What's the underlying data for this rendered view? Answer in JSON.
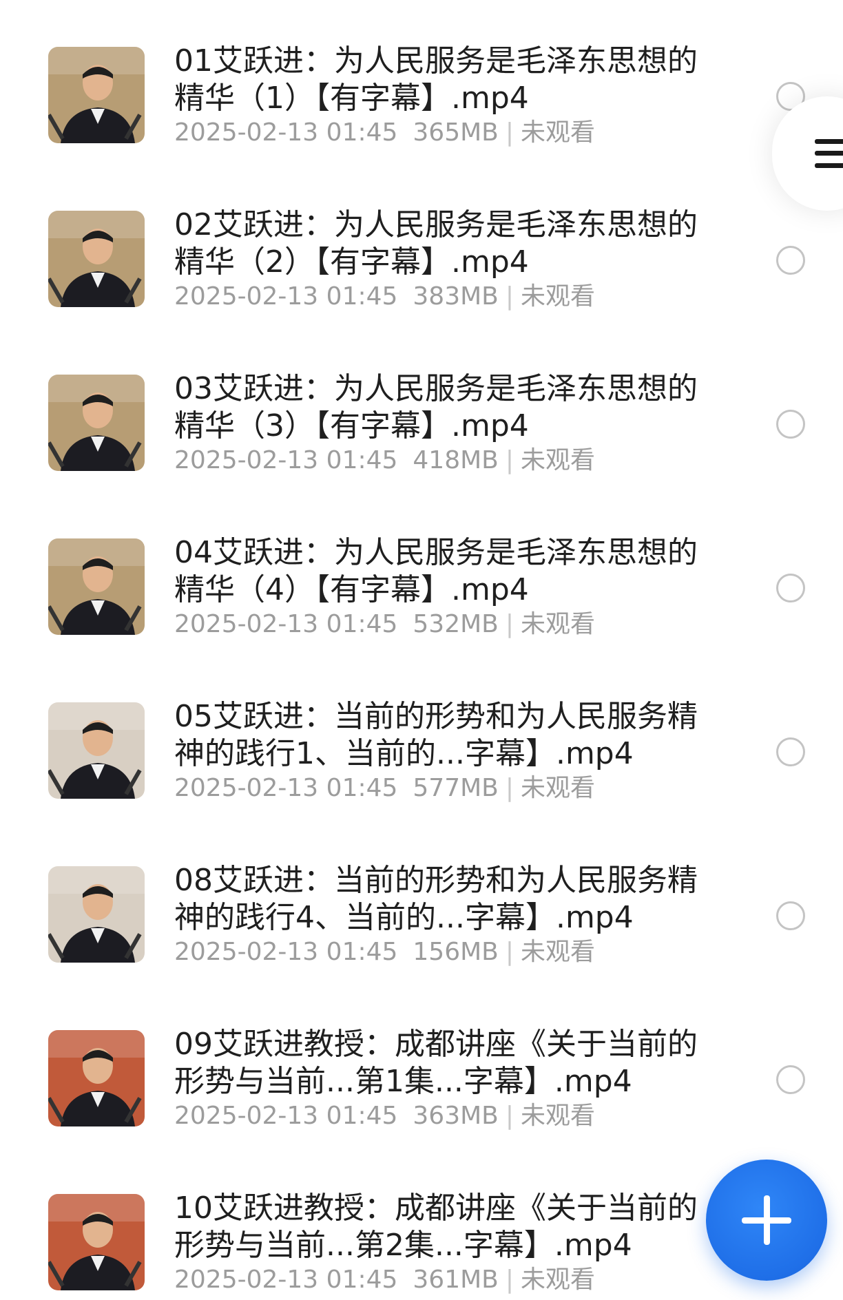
{
  "files": [
    {
      "title": "01艾跃进：为人民服务是毛泽东思想的精华（1）【有字幕】.mp4",
      "date": "2025-02-13 01:45",
      "size": "365MB",
      "status": "未观看",
      "thumb": "lecture-indoor"
    },
    {
      "title": "02艾跃进：为人民服务是毛泽东思想的精华（2）【有字幕】.mp4",
      "date": "2025-02-13 01:45",
      "size": "383MB",
      "status": "未观看",
      "thumb": "lecture-indoor"
    },
    {
      "title": "03艾跃进：为人民服务是毛泽东思想的精华（3）【有字幕】.mp4",
      "date": "2025-02-13 01:45",
      "size": "418MB",
      "status": "未观看",
      "thumb": "lecture-indoor"
    },
    {
      "title": "04艾跃进：为人民服务是毛泽东思想的精华（4）【有字幕】.mp4",
      "date": "2025-02-13 01:45",
      "size": "532MB",
      "status": "未观看",
      "thumb": "lecture-indoor"
    },
    {
      "title": "05艾跃进：当前的形势和为人民服务精神的践行1、当前的...字幕】.mp4",
      "date": "2025-02-13 01:45",
      "size": "577MB",
      "status": "未观看",
      "thumb": "lecture-wall"
    },
    {
      "title": "08艾跃进：当前的形势和为人民服务精神的践行4、当前的...字幕】.mp4",
      "date": "2025-02-13 01:45",
      "size": "156MB",
      "status": "未观看",
      "thumb": "lecture-wall"
    },
    {
      "title": "09艾跃进教授：成都讲座《关于当前的形势与当前...第1集...字幕】.mp4",
      "date": "2025-02-13 01:45",
      "size": "363MB",
      "status": "未观看",
      "thumb": "lecture-red"
    },
    {
      "title": "10艾跃进教授：成都讲座《关于当前的形势与当前...第2集...字幕】.mp4",
      "date": "2025-02-13 01:45",
      "size": "361MB",
      "status": "未观看",
      "thumb": "lecture-red"
    }
  ],
  "icons": {
    "menu": "menu-icon",
    "add": "plus-icon",
    "select": "radio-icon"
  },
  "colors": {
    "title": "#1f1f1f",
    "meta": "#9c9c9c",
    "accent": "#1f6fe8"
  }
}
